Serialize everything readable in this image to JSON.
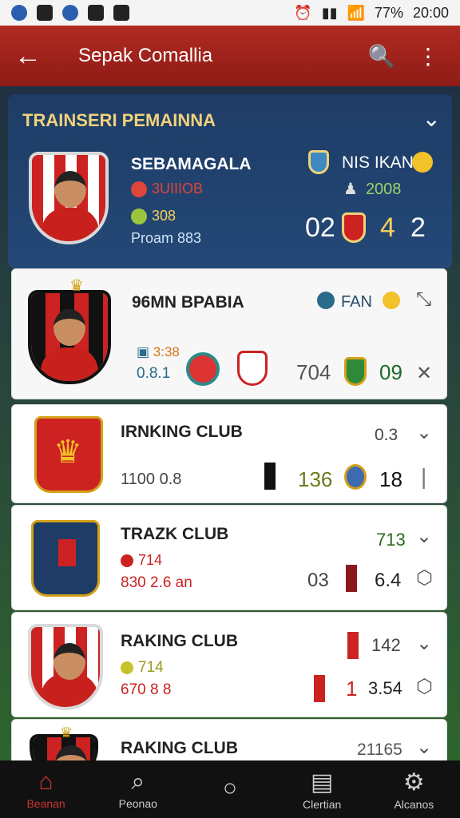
{
  "status": {
    "battery": "77%",
    "time": "20:00"
  },
  "appbar": {
    "title": "Sepak Comallia"
  },
  "section": {
    "title": "TRAINSERI PEMAINNA"
  },
  "featured": {
    "name": "SEBAMAGALA",
    "line1": "3UIIIOB",
    "line2": "308",
    "line3": "Proam 883",
    "opponent": "NIS IKAN",
    "opp_value": "2008",
    "score_a": "02",
    "score_b": "4",
    "score_c": "2"
  },
  "card2": {
    "name": "96MN BPABIA",
    "tag": "FAN",
    "val1": "3:38",
    "val2": "0.8.1",
    "score": "704",
    "right": "09"
  },
  "card3": {
    "name": "IRNKING CLUB",
    "right_top": "0.3",
    "val1": "1100 0.8",
    "score": "136",
    "right": "18"
  },
  "card4": {
    "name": "TRAZK CLUB",
    "right_top": "713",
    "val1": "714",
    "val2": "830 2.6 an",
    "score": "03",
    "right": "6.4"
  },
  "card5": {
    "name": "RAKING CLUB",
    "right_top": "142",
    "val1": "714",
    "val2": "670 8 8",
    "score": "1",
    "right": "3.54"
  },
  "card6": {
    "name": "RAKING CLUB",
    "right_top": "21165"
  },
  "nav": {
    "items": [
      "Beanan",
      "Peonao",
      "Clertian",
      "Alcanos"
    ]
  }
}
